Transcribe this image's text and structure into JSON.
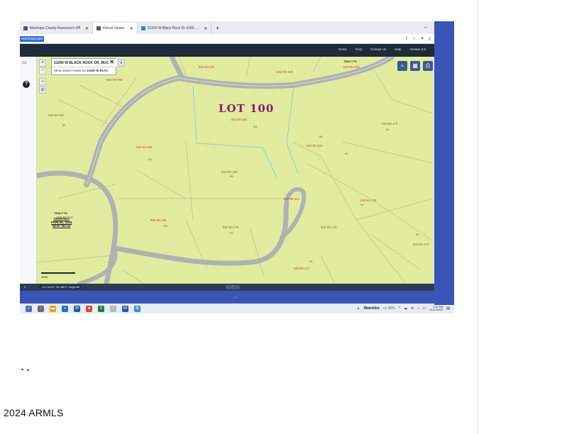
{
  "browser": {
    "tabs": [
      {
        "label": "Maricopa County Assessor's Off",
        "active": false
      },
      {
        "label": "Parcel Viewer",
        "active": true
      },
      {
        "label": "21260 W Black Rock Dr #100, ...",
        "active": false
      }
    ],
    "new_tab": "+",
    "url": "maricopa.gov",
    "win_min": "–",
    "win_max": "□",
    "win_close": "✕"
  },
  "site_nav": [
    "Home",
    "FAQ",
    "Contact Us",
    "Help",
    "Version 3.5"
  ],
  "search": {
    "value": "21260 W BLACK ROCK DR, BUC",
    "hint_prefix": "Show search results for",
    "hint_value": "21260 W BLAC"
  },
  "map": {
    "lot_note": "LOT 100",
    "parcels": [
      {
        "apn": "502-90-104"
      },
      {
        "apn": "502-90-103"
      },
      {
        "apn": "502-90-098"
      },
      {
        "apn": "502-90-097"
      },
      {
        "apn": "502-90-182"
      },
      {
        "apn": "502-90-183"
      },
      {
        "apn": "502-90-181"
      },
      {
        "apn": "502-90-180"
      },
      {
        "apn": "502-90-179"
      },
      {
        "apn": "502-90-175"
      },
      {
        "apn": "502-90-176"
      },
      {
        "apn": "502-90-177"
      },
      {
        "apn": "502-90-178"
      },
      {
        "apn": "502-90-184"
      },
      {
        "apn": "502-90-212"
      },
      {
        "apn": "502-90-172"
      },
      {
        "apn": "502-90-218"
      },
      {
        "apn": "502-90-219"
      }
    ],
    "lot_numbers": [
      "100",
      "101",
      "99",
      "98",
      "97",
      "92",
      "93",
      "94",
      "95",
      "96",
      "102",
      "91"
    ],
    "tract": "TRACT PL",
    "tract2": "TRACT PL",
    "verrado_lines": [
      "VERRADO",
      "PARCEL 3104",
      "MCR 752-41"
    ],
    "scale_label": "300ft",
    "coords": "-112.51217 33.48071 Degrees"
  },
  "taskbar": {
    "watchlist_label": "Watchlist",
    "watchlist_change": "+1.35%",
    "time": "2:52 PM",
    "date": "11/17/2023"
  },
  "watermark": "2024 ARMLS",
  "colors": {
    "map_bg": "#e1eca0",
    "road": "#aeb3b0",
    "parcel_line": "#c9b88a",
    "lot_outline": "#7fd3d0",
    "annotation": "#8c1a6b",
    "apn_text": "#b14c1c",
    "header": "#1f2a3b",
    "blue_band": "#3955b5"
  }
}
